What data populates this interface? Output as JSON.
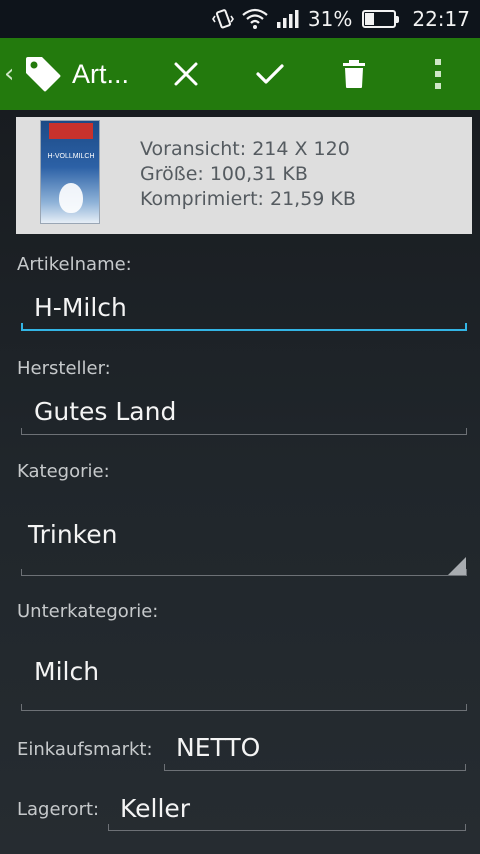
{
  "status_bar": {
    "battery": "31%",
    "battery_level": 0.31,
    "time": "22:17"
  },
  "action_bar": {
    "title": "Art...",
    "icons": [
      "chevron-left-icon",
      "tag-icon",
      "close-icon",
      "check-icon",
      "trash-icon",
      "more-vert-icon"
    ],
    "color": "#237a0d"
  },
  "preview": {
    "line1": "Voransicht: 214 X 120",
    "line2": "Größe: 100,31 KB",
    "line3": "Komprimiert: 21,59 KB",
    "thumb_text": "H-VOLLMILCH"
  },
  "form": {
    "artikelname": {
      "label": "Artikelname:",
      "value": "H-Milch"
    },
    "hersteller": {
      "label": "Hersteller:",
      "value": "Gutes Land"
    },
    "kategorie": {
      "label": "Kategorie:",
      "value": "Trinken"
    },
    "unterkategorie": {
      "label": "Unterkategorie:",
      "value": "Milch"
    },
    "einkaufsmarkt": {
      "label": "Einkaufsmarkt:",
      "value": "NETTO"
    },
    "lagerort": {
      "label": "Lagerort:",
      "value": "Keller"
    }
  },
  "colors": {
    "accent": "#33b5e5",
    "statusbar": "#0e141b"
  }
}
